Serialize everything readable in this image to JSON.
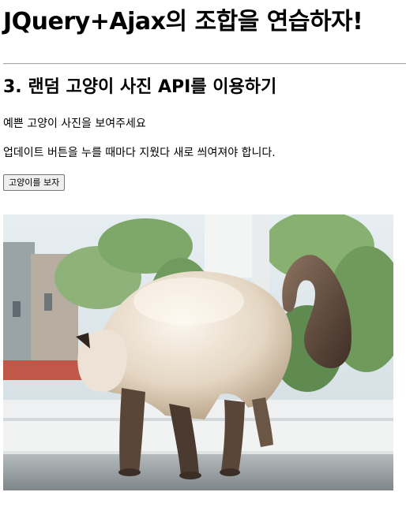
{
  "page": {
    "title": "JQuery+Ajax의 조합을 연습하자!",
    "section_title": "3. 랜덤 고양이 사진 API를 이용하기",
    "paragraph_1": "예쁜 고양이 사진을 보여주세요",
    "paragraph_2": "업데이트 버튼을 누를 때마다 지웠다 새로 씌여져야 합니다.",
    "button_label": "고양이를 보자"
  },
  "image": {
    "subject": "cat-photo",
    "colors": {
      "sky": "#dfe9ef",
      "tree": "#7da866",
      "window_frame": "#eef0f1",
      "floor": "#9aa1a4",
      "cat_fur": "#e6dccd",
      "cat_dark": "#4a3a2f"
    }
  }
}
